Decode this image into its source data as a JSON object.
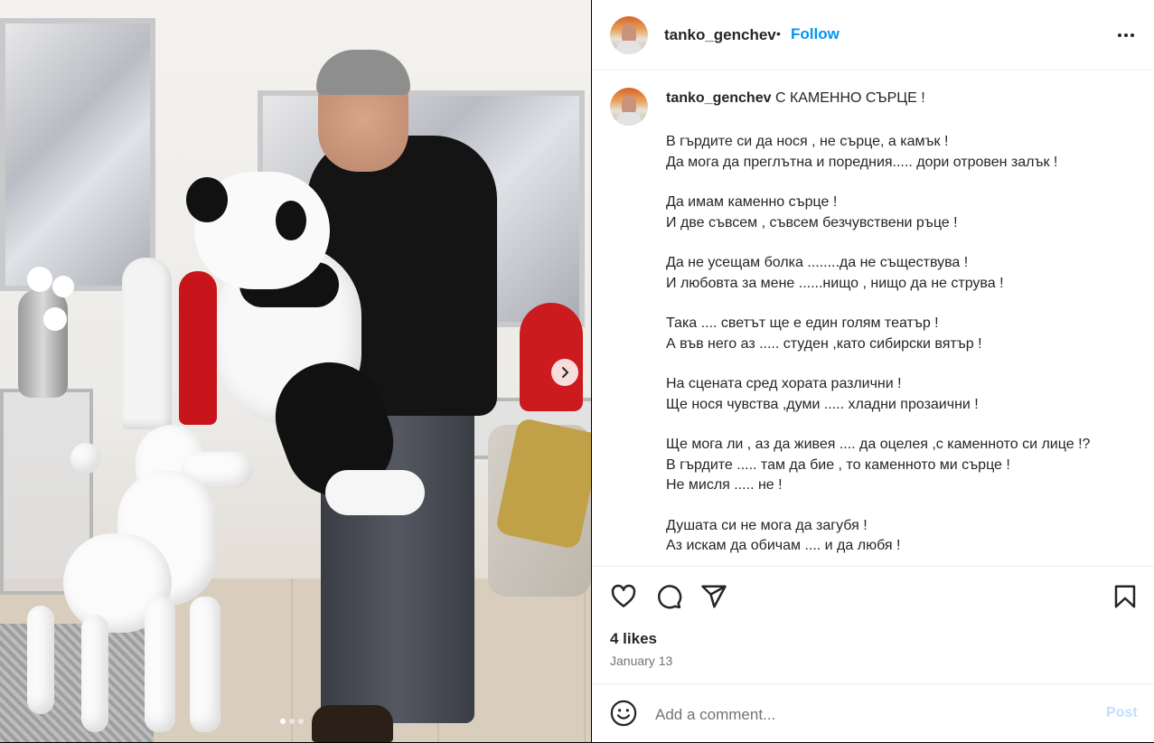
{
  "post": {
    "username": "tanko_genchev",
    "follow_label": "Follow",
    "separator": "•",
    "caption_title": "С КАМЕННО СЪРЦЕ !",
    "poem": [
      [
        "В гърдите си да нося , не сърце, а камък !",
        "Да мога да преглътна и поредния..... дори отровен залък !"
      ],
      [
        "Да имам каменно сърце !",
        "И две съвсем , съвсем безчувствени ръце !"
      ],
      [
        "Да не усещам болка ........да не съществува !",
        "И любовта за мене ......нищо , нищо да не струва !"
      ],
      [
        "Така .... светът ще е един голям театър !",
        "А във него аз ..... студен ,като сибирски вятър !"
      ],
      [
        "На сцената сред хората различни !",
        "Ще нося чувства ,думи ..... хладни прозаични !"
      ],
      [
        "Ще мога ли , аз да живея .... да оцелея ,с каменното си лице !?",
        "В гърдите ..... там да бие , то каменното ми сърце !",
        "Не мисля ..... не !"
      ],
      [
        "Душата си не мога да загубя !",
        "Аз искам да обичам .... и да любя !"
      ]
    ],
    "likes": "4 likes",
    "date": "January 13",
    "comment_placeholder": "Add a comment...",
    "post_label": "Post"
  },
  "carousel": {
    "total": 3,
    "current": 1
  },
  "icons": {
    "more": "more-options-icon",
    "like": "heart-icon",
    "comment": "comment-icon",
    "share": "share-icon",
    "save": "bookmark-icon",
    "emoji": "emoji-icon",
    "next": "chevron-right-icon"
  },
  "colors": {
    "follow": "#0095f6",
    "post_disabled": "#c0dffd",
    "muted": "#737373",
    "text": "#262626"
  }
}
